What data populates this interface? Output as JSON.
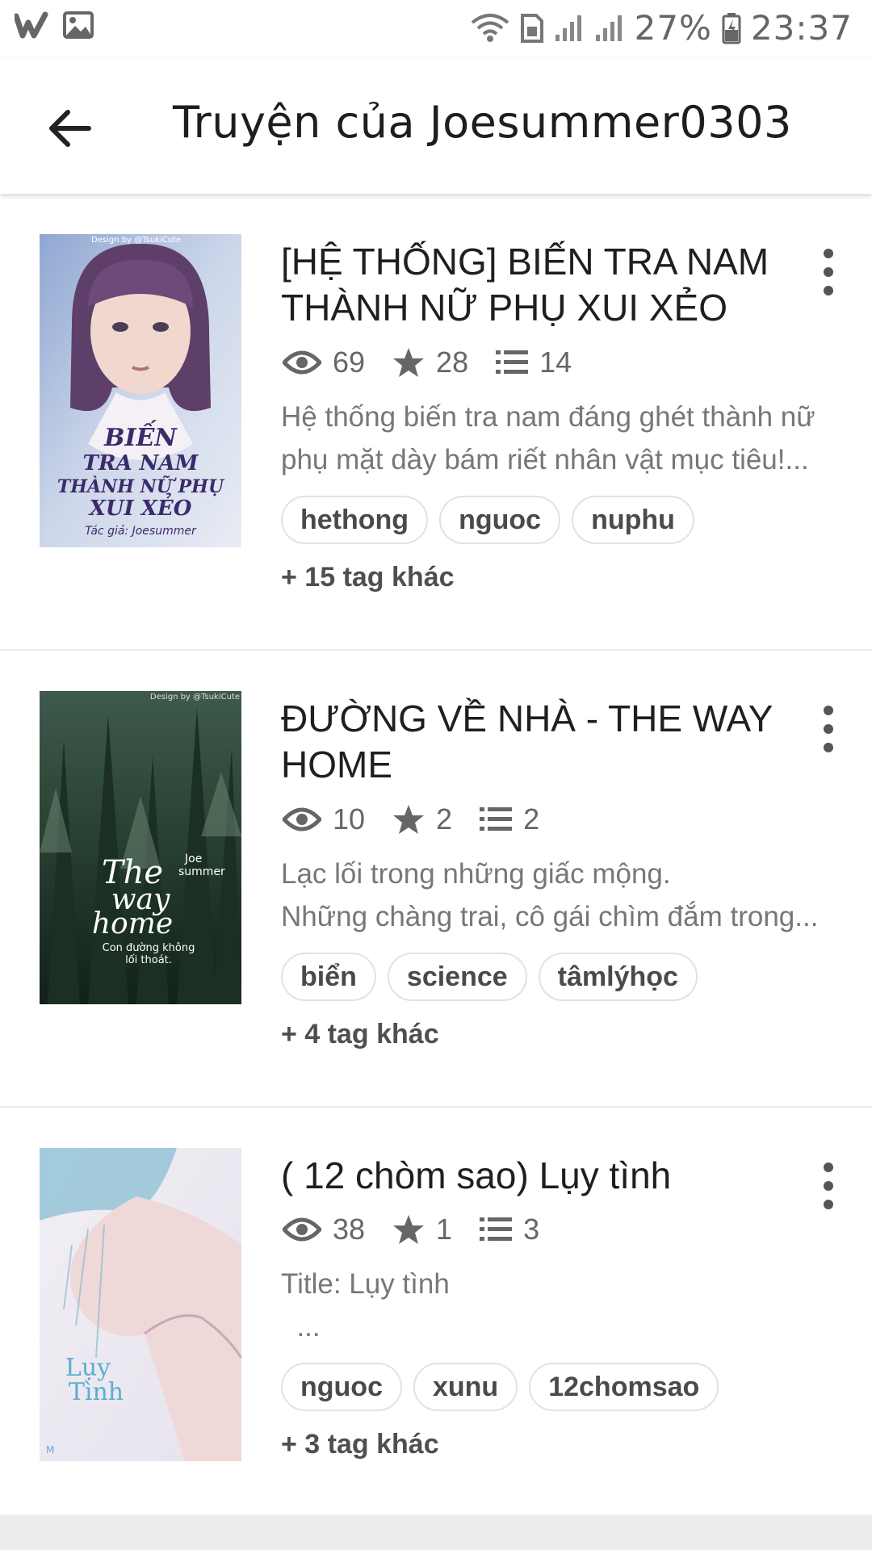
{
  "status_bar": {
    "battery": "27%",
    "time": "23:37"
  },
  "header": {
    "title": "Truyện của Joesummer0303"
  },
  "stories": [
    {
      "title_lines": [
        "[HỆ THỐNG] BIẾN TRA NAM",
        "THÀNH NỮ PHỤ XUI XẺO"
      ],
      "views": "69",
      "votes": "28",
      "parts": "14",
      "description": [
        "Hệ thống biến tra nam đáng ghét thành nữ",
        "phụ mặt dày bám riết nhân vật mục tiêu!..."
      ],
      "tags": [
        "hethong",
        "nguoc",
        "nuphu"
      ],
      "more_tags": "+ 15 tag khác",
      "cover_text": {
        "credit": "Design by @TsukiCute",
        "lines": [
          "BIẾN",
          "TRA NAM",
          "THÀNH NỮ PHỤ",
          "XUI XẺO"
        ],
        "author": "Tác giả: Joesummer"
      }
    },
    {
      "title_lines": [
        "ĐƯỜNG VỀ NHÀ -  THE WAY",
        "HOME"
      ],
      "views": "10",
      "votes": "2",
      "parts": "2",
      "description": [
        "Lạc lối trong những giấc mộng.",
        "Những chàng trai, cô gái chìm đắm trong..."
      ],
      "tags": [
        "biển",
        "science",
        "tâmlýhọc"
      ],
      "more_tags": "+ 4 tag khác",
      "cover_text": {
        "credit": "Design by @TsukiCute",
        "author_top": "Joe",
        "author_bottom": "summer",
        "lines": [
          "The",
          "way",
          "home"
        ],
        "subtitle": [
          "Con đường không",
          "lối thoát."
        ]
      }
    },
    {
      "title_lines": [
        "( 12 chòm sao) Lụy tình"
      ],
      "views": "38",
      "votes": "1",
      "parts": "3",
      "description": [
        "Title: Lụy tình",
        "  ..."
      ],
      "tags": [
        "nguoc",
        "xunu",
        "12chomsao"
      ],
      "more_tags": "+ 3 tag khác",
      "cover_text": {
        "lines": [
          "Lụy",
          "Tình"
        ],
        "mark": "M"
      }
    }
  ],
  "colors": {
    "accent_text": "#1f1f1f",
    "muted": "#777777",
    "tag_border": "#e2e2e2"
  }
}
